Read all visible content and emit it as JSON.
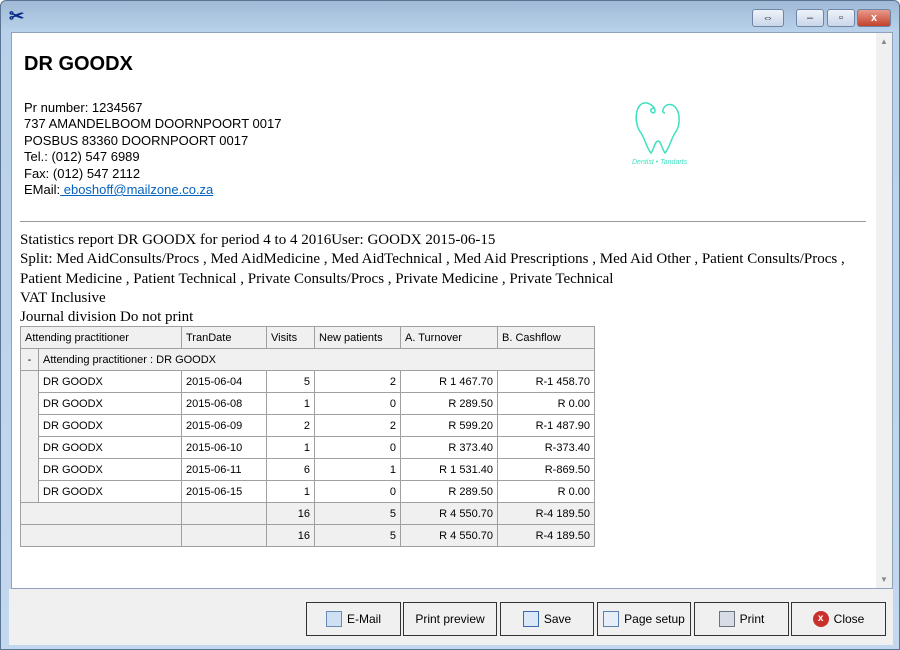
{
  "window": {
    "icon": "tools-icon",
    "buttons": {
      "resize": "⇔",
      "minimize": "–",
      "maximize": "▫",
      "close": "x"
    }
  },
  "header": {
    "title": "DR GOODX",
    "pr_number": "Pr number: 1234567",
    "address1": "737 AMANDELBOOM DOORNPOORT 0017",
    "address2": "POSBUS 83360 DOORNPOORT 0017",
    "tel": "Tel.: (012) 547 6989",
    "fax": "Fax: (012) 547 2112",
    "email_label": "EMail:",
    "email": " eboshoff@mailzone.co.za",
    "logo_text": "Dentist • Tandarts",
    "logo_color": "#3fe0c0"
  },
  "report": {
    "line1": "Statistics report DR GOODX for period 4 to 4 2016User: GOODX 2015-06-15",
    "line2": "Split: Med AidConsults/Procs , Med AidMedicine , Med AidTechnical , Med Aid Prescriptions , Med Aid Other , Patient Consults/Procs , Patient Medicine , Patient Technical , Private Consults/Procs , Private Medicine , Private Technical",
    "line3": "VAT Inclusive",
    "line4": "Journal division Do not print"
  },
  "table": {
    "columns": [
      "Attending practitioner",
      "TranDate",
      "Visits",
      "New patients",
      "A. Turnover",
      "B. Cashflow"
    ],
    "group_toggle": "-",
    "group_label": "Attending practitioner : DR GOODX",
    "rows": [
      [
        "DR GOODX",
        "2015-06-04",
        "5",
        "2",
        "R 1 467.70",
        "R-1 458.70"
      ],
      [
        "DR GOODX",
        "2015-06-08",
        "1",
        "0",
        "R 289.50",
        "R 0.00"
      ],
      [
        "DR GOODX",
        "2015-06-09",
        "2",
        "2",
        "R 599.20",
        "R-1 487.90"
      ],
      [
        "DR GOODX",
        "2015-06-10",
        "1",
        "0",
        "R 373.40",
        "R-373.40"
      ],
      [
        "DR GOODX",
        "2015-06-11",
        "6",
        "1",
        "R 1 531.40",
        "R-869.50"
      ],
      [
        "DR GOODX",
        "2015-06-15",
        "1",
        "0",
        "R 289.50",
        "R 0.00"
      ]
    ],
    "totals": [
      [
        "16",
        "5",
        "R 4 550.70",
        "R-4 189.50"
      ],
      [
        "16",
        "5",
        "R 4 550.70",
        "R-4 189.50"
      ]
    ]
  },
  "buttons": {
    "email": "E-Mail",
    "print_preview": "Print preview",
    "save": "Save",
    "page_setup": "Page setup",
    "print": "Print",
    "close": "Close"
  }
}
